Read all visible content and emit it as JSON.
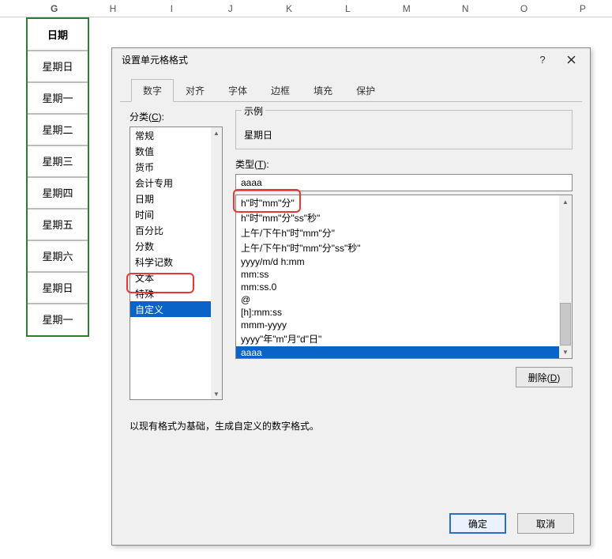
{
  "columns": [
    "",
    "G",
    "H",
    "I",
    "J",
    "K",
    "L",
    "M",
    "N",
    "O",
    "P"
  ],
  "selected_column": "G",
  "data_cells": [
    "日期",
    "星期日",
    "星期一",
    "星期二",
    "星期三",
    "星期四",
    "星期五",
    "星期六",
    "星期日",
    "星期一"
  ],
  "dialog": {
    "title": "设置单元格格式",
    "help": "?",
    "tabs": [
      "数字",
      "对齐",
      "字体",
      "边框",
      "填充",
      "保护"
    ],
    "active_tab": 0,
    "category_label_pre": "分类(",
    "category_label_key": "C",
    "category_label_post": "):",
    "categories": [
      "常规",
      "数值",
      "货币",
      "会计专用",
      "日期",
      "时间",
      "百分比",
      "分数",
      "科学记数",
      "文本",
      "特殊",
      "自定义"
    ],
    "selected_category_index": 11,
    "sample_legend": "示例",
    "sample_value": "星期日",
    "type_label_pre": "类型(",
    "type_label_key": "T",
    "type_label_post": "):",
    "type_value": "aaaa",
    "type_list": [
      "h\"时\"mm\"分\"",
      "h\"时\"mm\"分\"ss\"秒\"",
      "上午/下午h\"时\"mm\"分\"",
      "上午/下午h\"时\"mm\"分\"ss\"秒\"",
      "yyyy/m/d h:mm",
      "mm:ss",
      "mm:ss.0",
      "@",
      "[h]:mm:ss",
      "mmm-yyyy",
      "yyyy\"年\"m\"月\"d\"日\"",
      "aaaa"
    ],
    "selected_type_index": 11,
    "delete_label_pre": "删除(",
    "delete_label_key": "D",
    "delete_label_post": ")",
    "explain": "以现有格式为基础，生成自定义的数字格式。",
    "ok": "确定",
    "cancel": "取消"
  }
}
